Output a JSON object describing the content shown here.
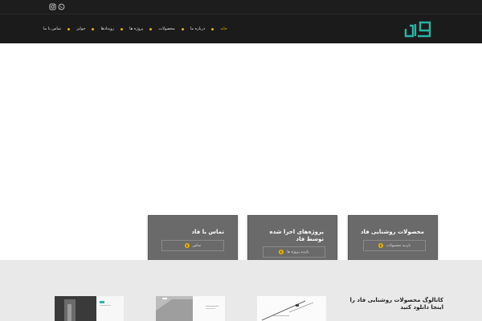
{
  "topbar": {
    "icons": [
      "whatsapp-icon",
      "instagram-icon"
    ]
  },
  "nav": {
    "items": [
      {
        "label": "خانه",
        "active": true
      },
      {
        "label": "درباره ما",
        "active": false
      },
      {
        "label": "محصولات",
        "active": false
      },
      {
        "label": "پروژه ها",
        "active": false
      },
      {
        "label": "رویدادها",
        "active": false
      },
      {
        "label": "جوایز",
        "active": false
      },
      {
        "label": "تماس با ما",
        "active": false
      }
    ]
  },
  "logo": {
    "icon": "fad-logo-icon",
    "color": "#2ab3a6"
  },
  "cards": [
    {
      "title": "محصولات روشنایی فاد",
      "button": "بازدید محصولات"
    },
    {
      "title": "پروژه‌های اجرا شده توسط فاد",
      "button": "بازدید پروژه ها"
    },
    {
      "title": "تماس با فاد",
      "button": "تماس"
    }
  ],
  "catalog": {
    "text": "کاتالوگ محصولات روشنایی فاد را اینجا دانلود کنید"
  },
  "colors": {
    "accent": "#e8b30a",
    "header_bg": "#1b1b1b",
    "card_bg": "#6a6a6a",
    "catalog_bg": "#e9e9e9"
  }
}
